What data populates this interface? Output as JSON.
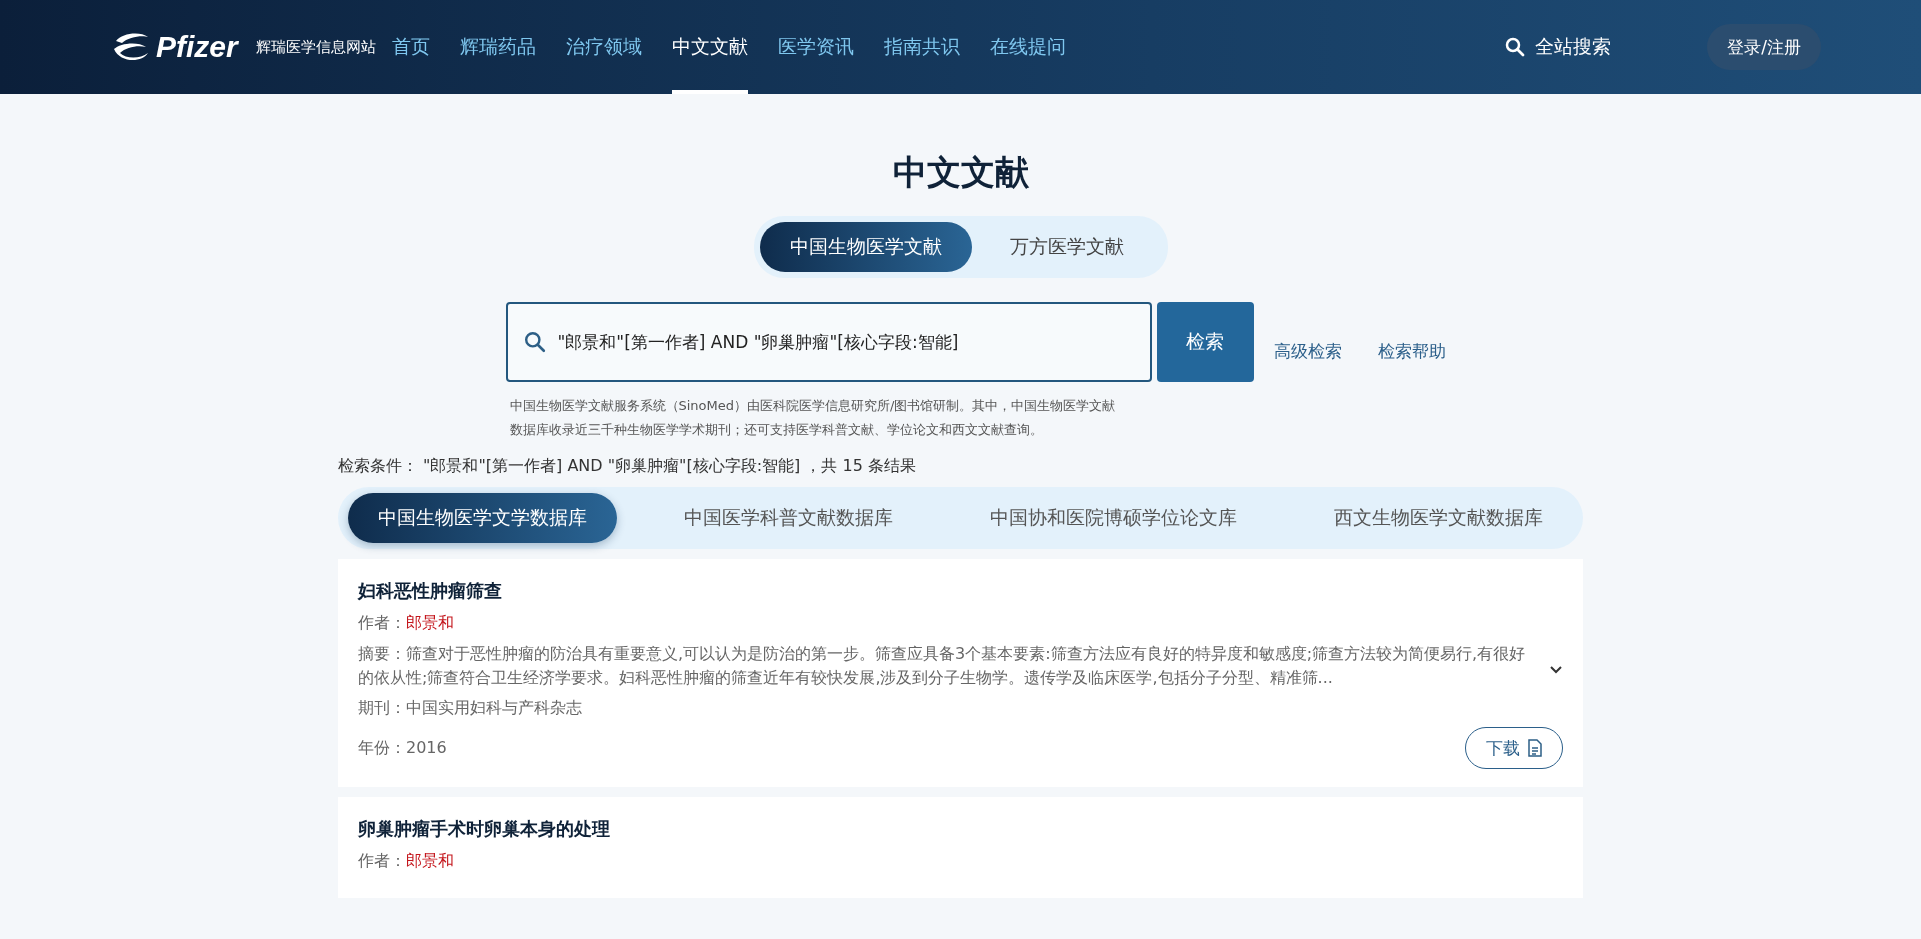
{
  "header": {
    "logo_text": "Pfizer",
    "site_name": "辉瑞医学信息网站",
    "nav": [
      {
        "label": "首页",
        "selected": false
      },
      {
        "label": "辉瑞药品",
        "selected": false
      },
      {
        "label": "治疗领域",
        "selected": false
      },
      {
        "label": "中文文献",
        "selected": true
      },
      {
        "label": "医学资讯",
        "selected": false
      },
      {
        "label": "指南共识",
        "selected": false
      },
      {
        "label": "在线提问",
        "selected": false
      }
    ],
    "search_label": "全站搜索",
    "login": "登录/注册"
  },
  "page_title": "中文文献",
  "source_toggle": [
    {
      "label": "中国生物医学文献",
      "selected": true
    },
    {
      "label": "万方医学文献",
      "selected": false
    }
  ],
  "search": {
    "value": "\"郎景和\"[第一作者] AND \"卵巢肿瘤\"[核心字段:智能]",
    "button": "检索",
    "links": [
      "高级检索",
      "检索帮助"
    ],
    "hint": "中国生物医学文献服务系统（SinoMed）由医科院医学信息研究所/图书馆研制。其中，中国生物医学文献数据库收录近三千种生物医学学术期刊；还可支持医学科普文献、学位论文和西文文献查询。"
  },
  "conditions": "检索条件：  \"郎景和\"[第一作者] AND \"卵巢肿瘤\"[核心字段:智能] ，共 15 条结果",
  "db_tabs": [
    {
      "label": "中国生物医学文学数据库",
      "selected": true
    },
    {
      "label": "中国医学科普文献数据库",
      "selected": false
    },
    {
      "label": "中国协和医院博硕学位论文库",
      "selected": false
    },
    {
      "label": "西文生物医学文献数据库",
      "selected": false
    }
  ],
  "results": [
    {
      "title": "妇科恶性肿瘤筛查",
      "author_label": "作者：",
      "author": "郎景和",
      "abstract": "摘要：筛查对于恶性肿瘤的防治具有重要意义,可以认为是防治的第一步。筛查应具备3个基本要素:筛查方法应有良好的特异度和敏感度;筛查方法较为简便易行,有很好的依从性;筛查符合卫生经济学要求。妇科恶性肿瘤的筛查近年有较快发展,涉及到分子生物学。遗传学及临床医学,包括分子分型、精准筛...",
      "expanded": false,
      "journal": "期刊：中国实用妇科与产科杂志",
      "year": "年份：2016",
      "download": "下载"
    },
    {
      "title": "卵巢肿瘤手术时卵巢本身的处理",
      "author_label": "作者：",
      "author": "郎景和"
    }
  ]
}
